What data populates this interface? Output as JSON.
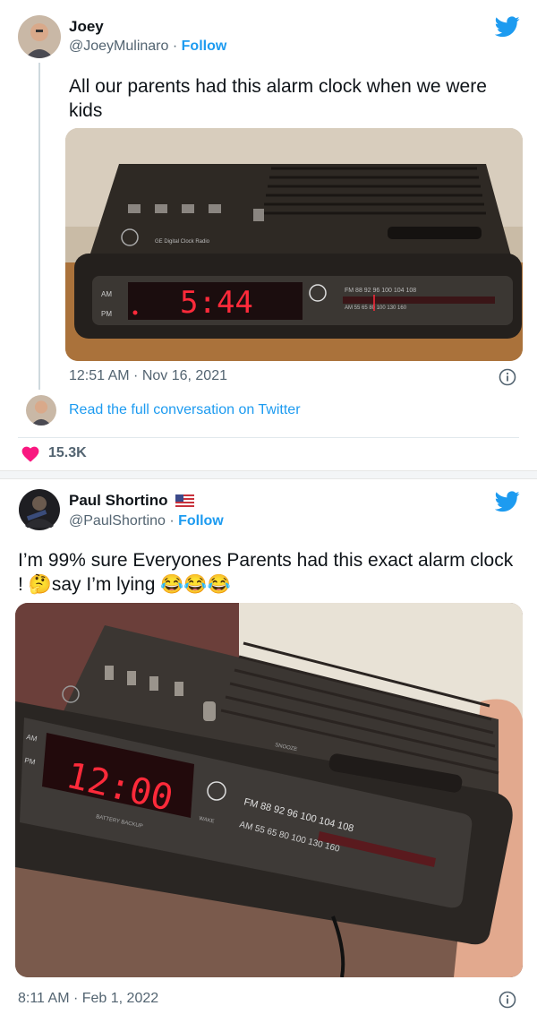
{
  "tweets": [
    {
      "name": "Joey",
      "handle": "@JoeyMulinaro",
      "separator": "·",
      "follow_label": "Follow",
      "text": "All our parents had this alarm clock when we were kids",
      "clock_display": "5:44",
      "timestamp": "12:51 AM · Nov 16, 2021",
      "read_more": "Read the full conversation on Twitter",
      "likes": "15.3K"
    },
    {
      "name": "Paul Shortino",
      "handle": "@PaulShortino",
      "separator": "·",
      "follow_label": "Follow",
      "text_part1": "I’m 99% sure Everyones Parents had this exact alarm clock !",
      "emoji_think": "🤔",
      "text_part2": "say I’m lying",
      "emoji_laugh": "😂😂😂",
      "clock_display": "12:00",
      "timestamp": "8:11 AM · Feb 1, 2022"
    }
  ],
  "clock_labels": {
    "brand": "GE Digital Clock Radio",
    "am": "AM",
    "pm": "PM",
    "fm_scale": "FM 88  92  96  100  104  108",
    "am_scale": "AM  55  65  80  100  130  160",
    "mhz": "MHz",
    "khz": "KHz",
    "wake": "WAKE",
    "snooze": "SNOOZE",
    "battery": "BATTERY BACKUP"
  },
  "colors": {
    "link": "#1d9bf0",
    "heart": "#f91880",
    "led": "#ff2a3a"
  }
}
